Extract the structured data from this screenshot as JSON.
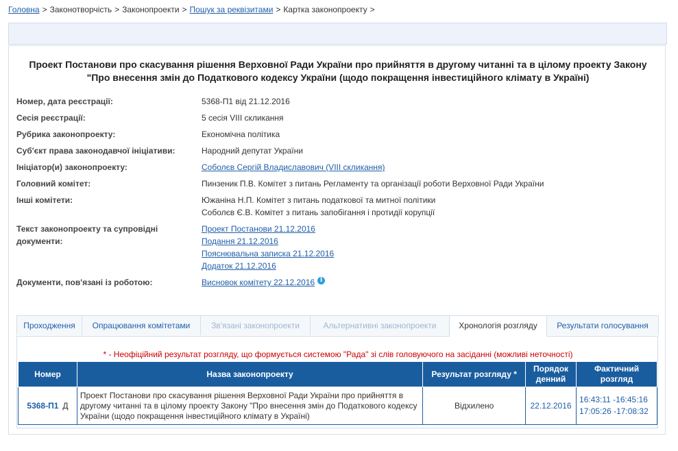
{
  "breadcrumb": {
    "home": "Головна",
    "lawmaking": "Законотворчість",
    "bills": "Законопроекти",
    "search": "Пошук за реквізитами",
    "card": "Картка законопроекту",
    "separator": ">"
  },
  "title": "Проект Постанови про скасування рішення Верховної Ради України про прийняття в другому читанні та в цілому проекту Закону \"Про внесення змін до Податкового кодексу України (щодо покращення інвестиційного клімату в Україні)",
  "props": {
    "reg_label": "Номер, дата реєстрації:",
    "reg_value": "5368-П1 від 21.12.2016",
    "session_label": "Сесія реєстрації:",
    "session_value": "5 сесія VIII скликання",
    "rubric_label": "Рубрика законопроекту:",
    "rubric_value": "Економічна політика",
    "subject_label": "Суб'єкт права законодавчої ініціативи:",
    "subject_value": "Народний депутат України",
    "initiator_label": "Ініціатор(и) законопроекту:",
    "initiator_value": "Соболєв Сергій Владиславович (VIII скликання)",
    "main_committee_label": "Головний комітет:",
    "main_committee_value": "Пинзеник П.В. Комітет з питань Регламенту та організації роботи Верховної Ради України",
    "other_committees_label": "Інші комітети:",
    "other_committees": [
      "Южаніна Н.П. Комітет з питань податкової та митної політики",
      "Соболєв Є.В. Комітет з питань запобігання і протидії корупції"
    ],
    "texts_label_1": "Текст законопроекту та супровідні",
    "texts_label_2": "документи:",
    "texts": [
      "Проект Постанови 21.12.2016",
      "Подання 21.12.2016",
      "Пояснювальна записка 21.12.2016",
      "Додаток 21.12.2016"
    ],
    "related_label": "Документи, пов'язані із роботою:",
    "related_value": "Висновок комітету 22.12.2016",
    "info_icon_glyph": "i"
  },
  "tabs": [
    {
      "label": "Проходження"
    },
    {
      "label": "Опрацювання комітетами"
    },
    {
      "label": "Зв'язані законопроекти"
    },
    {
      "label": "Альтернативні законопроекти"
    },
    {
      "label": "Хронологія розгляду"
    },
    {
      "label": "Результати голосування"
    }
  ],
  "note": "* - Неофіційний результат розгляду, що формується системою \"Рада\" зі слів головуючого на засіданні (можливі неточності)",
  "table": {
    "headers": [
      "Номер",
      "Назва законопроекту",
      "Результат розгляду *",
      "Порядок денний",
      "Фактичний розгляд"
    ],
    "row": {
      "number": "5368-П1",
      "marker": "Д",
      "name": "Проект Постанови про скасування рішення Верховної Ради України про прийняття в другому читанні та в цілому проекту Закону \"Про внесення змін до Податкового кодексу України (щодо покращення інвестиційного клімату в Україні)",
      "result": "Відхилено",
      "agenda_date": "22.12.2016",
      "actual_1": "16:43:11 -16:45:16",
      "actual_2": "17:05:26 -17:08:32"
    }
  },
  "colors": {
    "link": "#1f5ea8",
    "header_bg": "#1a5d9f",
    "note": "#cc0000"
  }
}
